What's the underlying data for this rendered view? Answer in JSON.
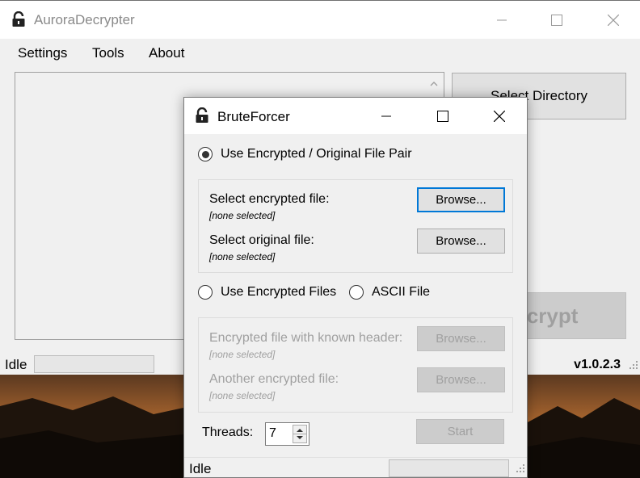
{
  "main": {
    "title": "AuroraDecrypter",
    "menu": [
      "Settings",
      "Tools",
      "About"
    ],
    "select_directory_label": "Select Directory",
    "decrypt_label": "Decrypt",
    "status": "Idle",
    "version": "v1.0.2.3"
  },
  "dialog": {
    "title": "BruteForcer",
    "mode_pair_label": "Use Encrypted / Original File Pair",
    "mode_pair_selected": true,
    "encrypted_file_label": "Select encrypted file:",
    "encrypted_file_value": "[none selected]",
    "original_file_label": "Select original file:",
    "original_file_value": "[none selected]",
    "browse_label": "Browse...",
    "mode_encrypted_files_label": "Use Encrypted Files",
    "mode_ascii_label": "ASCII File",
    "known_header_label": "Encrypted file with known header:",
    "known_header_value": "[none selected]",
    "another_file_label": "Another encrypted file:",
    "another_file_value": "[none selected]",
    "threads_label": "Threads:",
    "threads_value": "7",
    "start_label": "Start",
    "status": "Idle"
  },
  "colors": {
    "accent": "#0078d7",
    "disabled_text": "#a0a0a0",
    "window_bg": "#f0f0f0"
  }
}
